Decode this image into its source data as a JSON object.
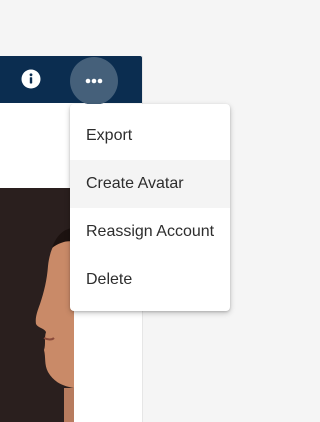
{
  "toolbar": {
    "info_icon": "info-icon",
    "more_icon": "more-horizontal-icon",
    "background_color": "#0b2d50",
    "active_button_color": "#45607a"
  },
  "image": {
    "description_icon": "profile-photo"
  },
  "menu": {
    "items": [
      {
        "label": "Export"
      },
      {
        "label": "Create Avatar"
      },
      {
        "label": "Reassign Account"
      },
      {
        "label": "Delete"
      }
    ],
    "highlighted": "Create Avatar"
  }
}
